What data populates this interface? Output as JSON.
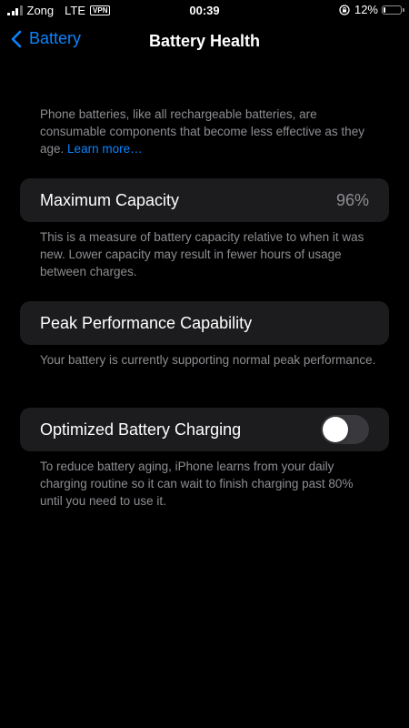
{
  "status_bar": {
    "carrier": "Zong",
    "network": "LTE",
    "vpn": "VPN",
    "time": "00:39",
    "battery_percent": "12%",
    "battery_level": 0.12,
    "icons": [
      "signal-icon",
      "vpn-badge",
      "orientation-lock-icon",
      "battery-icon"
    ]
  },
  "nav": {
    "back_label": "Battery",
    "title": "Battery Health"
  },
  "intro": {
    "text": "Phone batteries, like all rechargeable batteries, are consumable components that become less effective as they age.",
    "link": "Learn more…"
  },
  "maximum_capacity": {
    "label": "Maximum Capacity",
    "value": "96%",
    "footer": "This is a measure of battery capacity relative to when it was new. Lower capacity may result in fewer hours of usage between charges."
  },
  "peak_performance": {
    "label": "Peak Performance Capability",
    "footer": "Your battery is currently supporting normal peak performance."
  },
  "optimized_charging": {
    "label": "Optimized Battery Charging",
    "enabled": false,
    "footer": "To reduce battery aging, iPhone learns from your daily charging routine so it can wait to finish charging past 80% until you need to use it."
  },
  "colors": {
    "background": "#000000",
    "cell": "#1c1c1e",
    "accent": "#0a84ff",
    "secondary_text": "#8e8e93",
    "toggle_off": "#39393d"
  }
}
